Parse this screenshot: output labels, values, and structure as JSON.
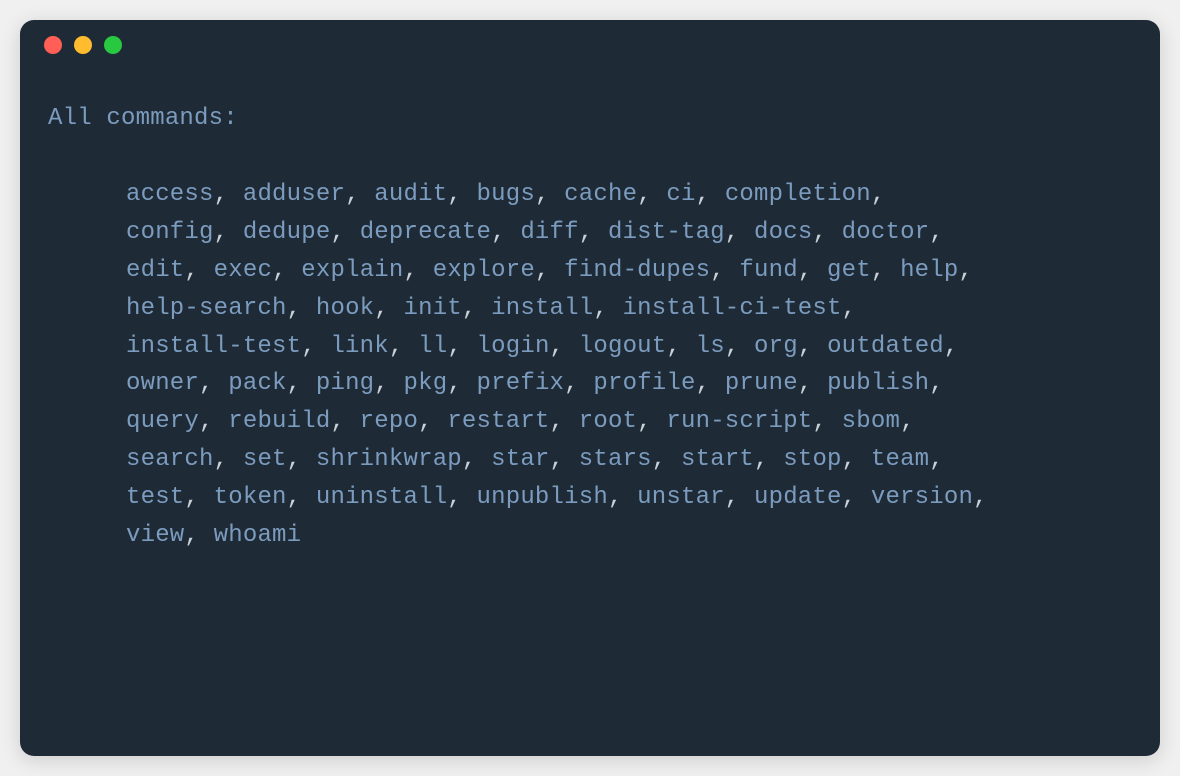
{
  "header": "All commands:",
  "commands": [
    "access",
    "adduser",
    "audit",
    "bugs",
    "cache",
    "ci",
    "completion",
    "config",
    "dedupe",
    "deprecate",
    "diff",
    "dist-tag",
    "docs",
    "doctor",
    "edit",
    "exec",
    "explain",
    "explore",
    "find-dupes",
    "fund",
    "get",
    "help",
    "help-search",
    "hook",
    "init",
    "install",
    "install-ci-test",
    "install-test",
    "link",
    "ll",
    "login",
    "logout",
    "ls",
    "org",
    "outdated",
    "owner",
    "pack",
    "ping",
    "pkg",
    "prefix",
    "profile",
    "prune",
    "publish",
    "query",
    "rebuild",
    "repo",
    "restart",
    "root",
    "run-script",
    "sbom",
    "search",
    "set",
    "shrinkwrap",
    "star",
    "stars",
    "start",
    "stop",
    "team",
    "test",
    "token",
    "uninstall",
    "unpublish",
    "unstar",
    "update",
    "version",
    "view",
    "whoami"
  ],
  "line_breaks_after": [
    "completion",
    "doctor",
    "help",
    "install-ci-test",
    "outdated",
    "publish",
    "sbom",
    "team",
    "version"
  ]
}
